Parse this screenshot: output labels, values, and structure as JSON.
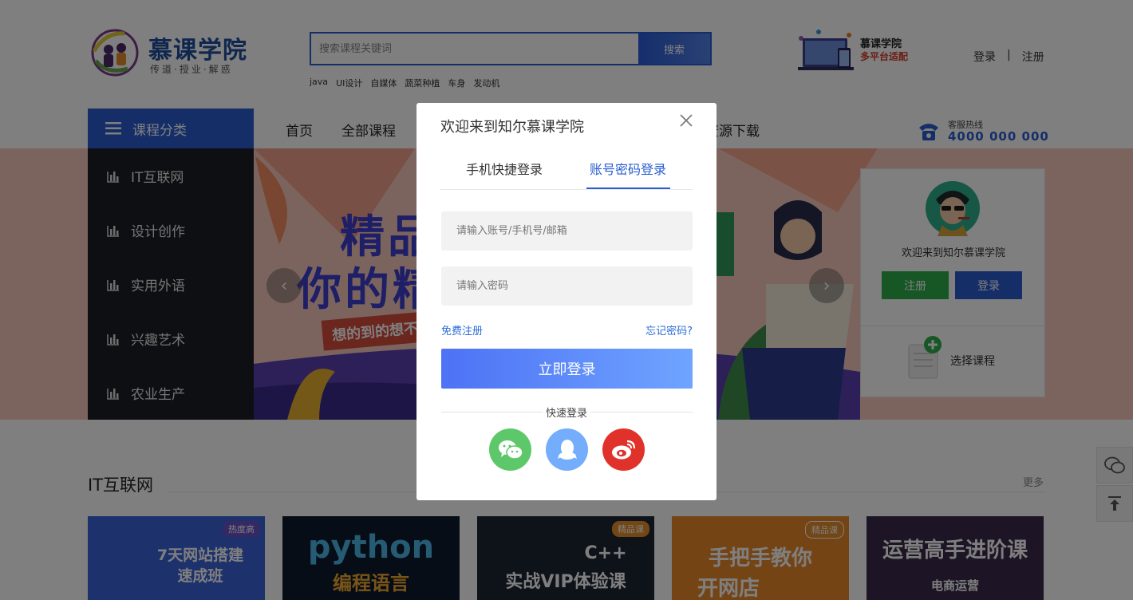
{
  "header": {
    "logo_title": "慕课学院",
    "logo_slogan": "传道·授业·解惑",
    "search": {
      "placeholder": "搜索课程关键词",
      "button_label": "搜索"
    },
    "hot_words": [
      "java",
      "UI设计",
      "自媒体",
      "蔬菜种植",
      "车身",
      "发动机"
    ],
    "app_promo": {
      "title": "慕课学院",
      "subtitle": "多平台适配"
    },
    "login_link": "登录",
    "separator": "|",
    "register_link": "注册"
  },
  "nav": {
    "category_label": "课程分类",
    "items": [
      "首页",
      "全部课程",
      "",
      "资源下载"
    ],
    "hotline_label": "客服热线",
    "hotline_number": "4000 000 000"
  },
  "sidebar": {
    "items": [
      {
        "label": "IT互联网"
      },
      {
        "label": "设计创作"
      },
      {
        "label": "实用外语"
      },
      {
        "label": "兴趣艺术"
      },
      {
        "label": "农业生产"
      }
    ]
  },
  "banner": {
    "headline1": "精品",
    "headline2": "你的精",
    "tag": "想的到的想不"
  },
  "welcome_card": {
    "welcome_text": "欢迎来到知尔慕课学院",
    "register_label": "注册",
    "login_label": "登录",
    "select_course_label": "选择课程"
  },
  "section": {
    "title": "IT互联网",
    "more": "更多",
    "courses": [
      {
        "badge": "热度高",
        "line1": "7天网站搭建",
        "line2": "速成班",
        "bg": "#3a63d8",
        "badge_bg": "#6b53c9"
      },
      {
        "badge": "",
        "line1": "python",
        "line2": "编程语言",
        "bg": "#0f1a2c",
        "badge_bg": ""
      },
      {
        "badge": "精品课",
        "line1": "C++",
        "line2": "实战VIP体验课",
        "bg": "#1c2532",
        "badge_bg": "#e58d2a"
      },
      {
        "badge": "精品课",
        "line1": "手把手教你",
        "line2": "开网店",
        "bg": "#e8892b",
        "badge_bg": "#e58d2a"
      },
      {
        "badge": "",
        "line1": "运营高手进阶课",
        "line2": "电商运营",
        "bg": "#3b2a4a",
        "badge_bg": ""
      }
    ]
  },
  "modal": {
    "title": "欢迎来到知尔慕课学院",
    "tab_phone": "手机快捷登录",
    "tab_account": "账号密码登录",
    "account_placeholder": "请输入账号/手机号/邮箱",
    "password_placeholder": "请输入密码",
    "free_register": "免费注册",
    "forgot_password": "忘记密码?",
    "login_button": "立即登录",
    "quick_login": "快速登录",
    "social": [
      "wechat",
      "qq",
      "weibo"
    ]
  },
  "colors": {
    "primary": "#2a5cd1",
    "register_green": "#2eaf4c",
    "wechat": "#5dc86a",
    "qq": "#74adfb",
    "weibo": "#e0322b",
    "login_gradient_start": "#4d72f5",
    "login_gradient_end": "#6fa4ff"
  }
}
